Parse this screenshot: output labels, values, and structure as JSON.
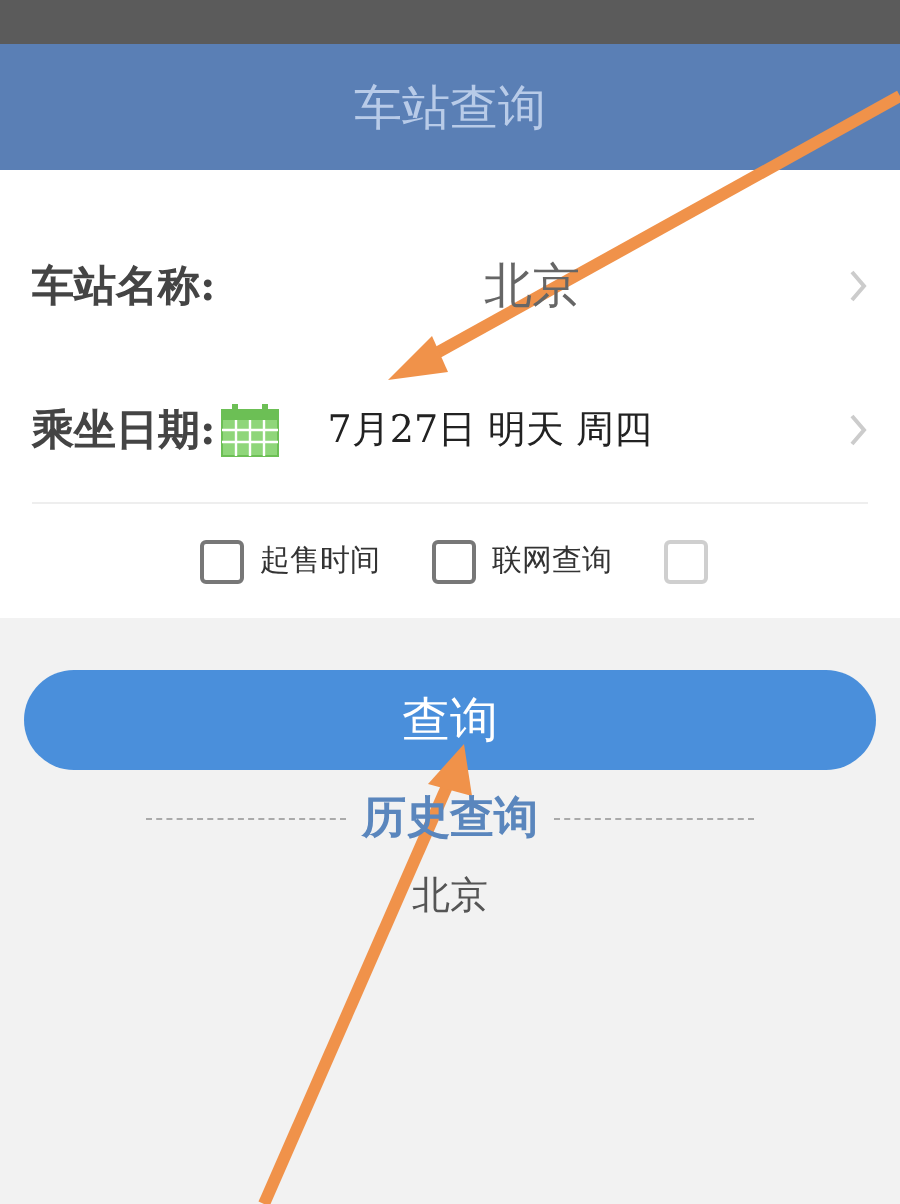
{
  "header": {
    "title": "车站查询"
  },
  "form_rows": [
    {
      "kind": "station",
      "label": "车站名称:",
      "value": "北京"
    },
    {
      "kind": "date",
      "label": "乘坐日期:",
      "value": "7月27日 明天 周四"
    }
  ],
  "options": [
    {
      "label": "起售时间",
      "checked": false
    },
    {
      "label": "联网查询",
      "checked": false
    },
    {
      "checked": false
    }
  ],
  "query_button": "查询",
  "history": {
    "title": "历史查询",
    "items": [
      "北京"
    ]
  }
}
